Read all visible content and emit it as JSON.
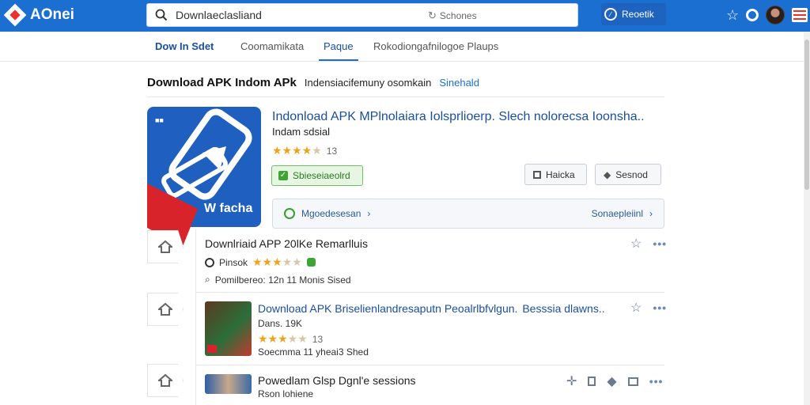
{
  "brand": {
    "name": "AOnei"
  },
  "search": {
    "value": "Downlaeclasliand",
    "hint": "Schones"
  },
  "top_button": {
    "label": "Reoetik"
  },
  "nav": {
    "tabs": [
      {
        "label": "Dow In Sdet"
      },
      {
        "label": "Coomamikata"
      },
      {
        "label": "Paque"
      },
      {
        "label": "Rokodiongafnilogoe Plaups"
      }
    ]
  },
  "breadcrumb": {
    "title": "Download APK Indom APk",
    "subtitle": "Indensiacifemuny osomkain",
    "link": "Sinehald"
  },
  "featured": {
    "title": "Indonload APK MPlnolaiara Iolsprlioerp. Slech nolorecsa Ioonsha..",
    "developer": "Indam sdsial",
    "rating": 4,
    "rating_count": "13",
    "icon_caption": "W facha",
    "install_label": "Sbieseiaeolrd",
    "btn_1": "Haicka",
    "btn_2": "Sesnod",
    "info_left": "Mgoedesesan",
    "info_right": "Sonaepleiinl"
  },
  "list": [
    {
      "title": "Downlriaid APP 20lKe Remarlluis",
      "line1_label": "Pinsok",
      "line1_rating": 3.5,
      "line2": "Pomilbereo: 12n 11 Monis Sised"
    },
    {
      "title": "Download APK Briselienlandresaputn Peoalrlbfvlgun.",
      "title_tail": "Besssia dlawns..",
      "line1": "Dans. 19K",
      "line2_rating": 3.5,
      "line2_count": "13",
      "line3": "Soecmma 11 yheai3 Shed"
    },
    {
      "title": "Powedlam Glsp Dgnl'e sessions",
      "line1": "Rson lohiene"
    }
  ],
  "colors": {
    "accent": "#1a6fd0",
    "brand_red": "#e8322e",
    "install_green": "#3ea535"
  }
}
